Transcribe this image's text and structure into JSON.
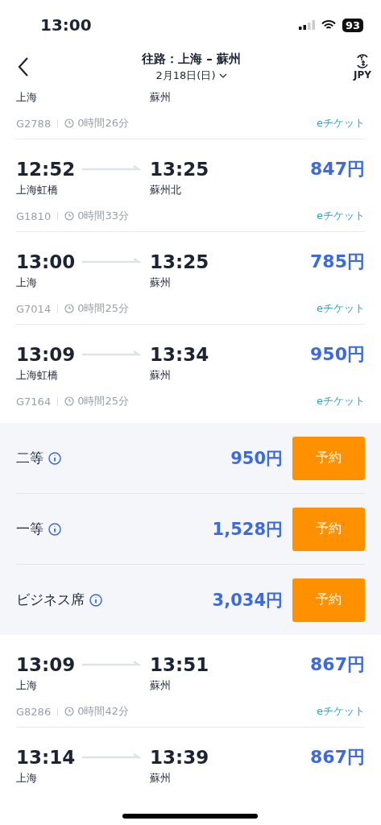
{
  "status_bar": {
    "time": "13:00",
    "battery": "93"
  },
  "header": {
    "title": "往路：上海 – 蘇州",
    "date": "2月18日(日)",
    "currency": "JPY"
  },
  "trains": [
    {
      "kind": "partial",
      "from_station": "上海",
      "to_station": "蘇州",
      "number": "G2788",
      "duration": "0時間26分",
      "ticket": "eチケット"
    },
    {
      "kind": "full",
      "depart": "12:52",
      "arrive": "13:25",
      "from_station": "上海虹橋",
      "to_station": "蘇州北",
      "price": "847円",
      "number": "G1810",
      "duration": "0時間33分",
      "ticket": "eチケット"
    },
    {
      "kind": "full",
      "depart": "13:00",
      "arrive": "13:25",
      "from_station": "上海",
      "to_station": "蘇州",
      "price": "785円",
      "number": "G7014",
      "duration": "0時間25分",
      "ticket": "eチケット"
    },
    {
      "kind": "full",
      "depart": "13:09",
      "arrive": "13:34",
      "from_station": "上海虹橋",
      "to_station": "蘇州",
      "price": "950円",
      "number": "G7164",
      "duration": "0時間25分",
      "ticket": "eチケット",
      "expanded": true,
      "classes": [
        {
          "name": "二等",
          "price": "950円",
          "button": "予約"
        },
        {
          "name": "一等",
          "price": "1,528円",
          "button": "予約"
        },
        {
          "name": "ビジネス席",
          "price": "3,034円",
          "button": "予約"
        }
      ]
    },
    {
      "kind": "full",
      "depart": "13:09",
      "arrive": "13:51",
      "from_station": "上海",
      "to_station": "蘇州",
      "price": "867円",
      "number": "G8286",
      "duration": "0時間42分",
      "ticket": "eチケット"
    },
    {
      "kind": "cut",
      "depart": "13:14",
      "arrive": "13:39",
      "from_station": "上海",
      "to_station": "蘇州",
      "price": "867円"
    }
  ]
}
